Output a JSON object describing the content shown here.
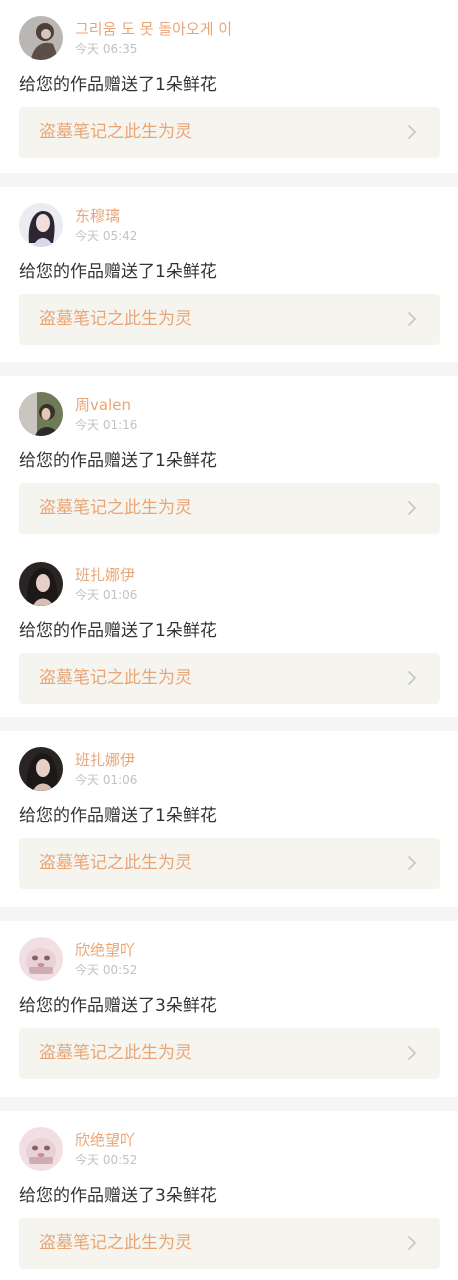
{
  "colors": {
    "accent": "#e8a677",
    "time": "#c2c2c2",
    "link_bg": "#f5f4ee",
    "chevron": "#c8c8c8",
    "separator": "#f5f5f5"
  },
  "notifications": [
    {
      "user": "그리움 도 못 돌아오게 이",
      "time": "今天 06:35",
      "message": "给您的作品赠送了1朵鲜花",
      "work_title": "盗墓笔记之此生为灵",
      "avatar": "avatar-user-1"
    },
    {
      "user": "东穆璃",
      "time": "今天 05:42",
      "message": "给您的作品赠送了1朵鲜花",
      "work_title": "盗墓笔记之此生为灵",
      "avatar": "avatar-user-2"
    },
    {
      "user": "周valen",
      "time": "今天 01:16",
      "message": "给您的作品赠送了1朵鲜花",
      "work_title": "盗墓笔记之此生为灵",
      "avatar": "avatar-user-3"
    },
    {
      "user": "班扎娜伊",
      "time": "今天 01:06",
      "message": "给您的作品赠送了1朵鲜花",
      "work_title": "盗墓笔记之此生为灵",
      "avatar": "avatar-user-4"
    },
    {
      "user": "班扎娜伊",
      "time": "今天 01:06",
      "message": "给您的作品赠送了1朵鲜花",
      "work_title": "盗墓笔记之此生为灵",
      "avatar": "avatar-user-4"
    },
    {
      "user": "欣绝望吖",
      "time": "今天 00:52",
      "message": "给您的作品赠送了3朵鲜花",
      "work_title": "盗墓笔记之此生为灵",
      "avatar": "avatar-user-5"
    },
    {
      "user": "欣绝望吖",
      "time": "今天 00:52",
      "message": "给您的作品赠送了3朵鲜花",
      "work_title": "盗墓笔记之此生为灵",
      "avatar": "avatar-user-5"
    }
  ]
}
